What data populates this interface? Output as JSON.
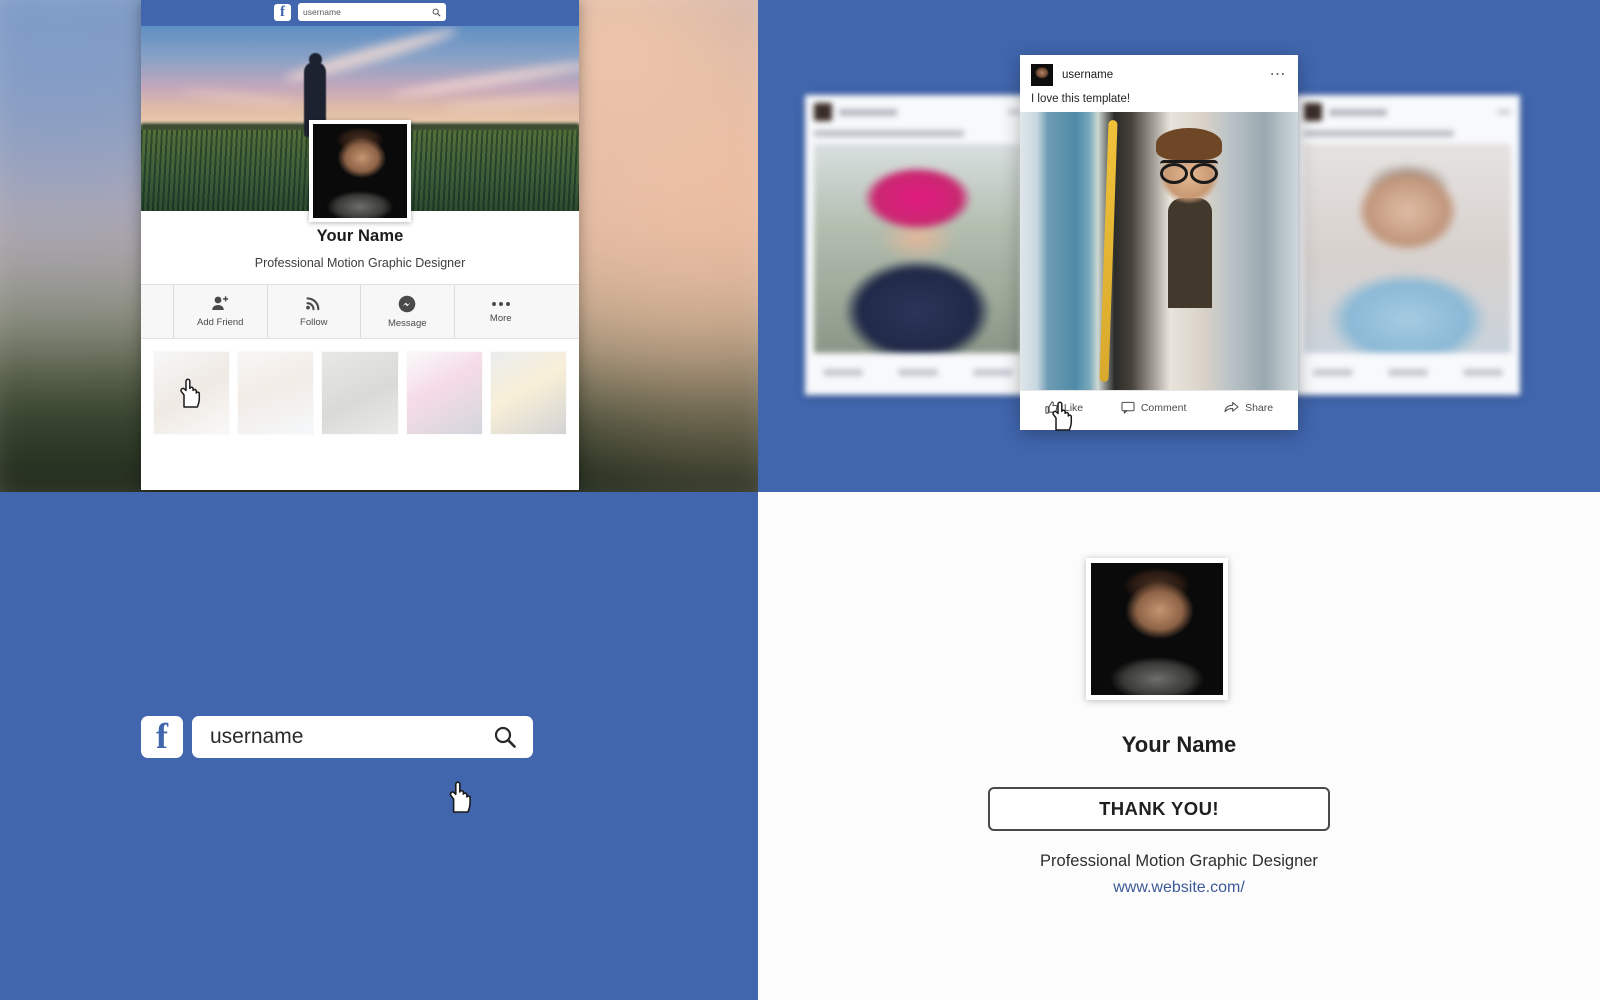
{
  "colors": {
    "facebook_blue": "#4166ae",
    "link_blue": "#3c5a9a",
    "panel_white": "#ffffff"
  },
  "profile_panel": {
    "topbar": {
      "logo": "facebook-f-logo",
      "search_value": "username",
      "search_icon": "search-icon"
    },
    "cover_photo_alt": "sunset-field-cover-photo",
    "avatar_alt": "profile-portrait",
    "name": "Your Name",
    "subtitle": "Professional Motion Graphic Designer",
    "actions": [
      {
        "label": "Add Friend",
        "icon": "add-friend-icon"
      },
      {
        "label": "Follow",
        "icon": "rss-follow-icon"
      },
      {
        "label": "Message",
        "icon": "messenger-icon"
      },
      {
        "label": "More",
        "icon": "ellipsis-icon"
      }
    ],
    "photo_strip": [
      "photo-thumbnail-1",
      "photo-thumbnail-2",
      "photo-thumbnail-3",
      "photo-thumbnail-4",
      "photo-thumbnail-5"
    ]
  },
  "feed_panel": {
    "post": {
      "username": "username",
      "menu_icon": "ellipsis-icon",
      "caption": "I love this template!",
      "image_alt": "man-with-glasses-on-train",
      "avatar_alt": "post-author-avatar",
      "actions": [
        {
          "label": "Like",
          "icon": "thumbs-up-icon"
        },
        {
          "label": "Comment",
          "icon": "comment-bubble-icon"
        },
        {
          "label": "Share",
          "icon": "share-arrow-icon"
        }
      ]
    },
    "background_posts": [
      {
        "image_alt": "girl-in-pink-hat-blurred"
      },
      {
        "image_alt": "girl-in-blue-dress-blurred"
      }
    ]
  },
  "search_panel": {
    "logo": "facebook-f-logo",
    "search_value": "username",
    "search_placeholder": "username",
    "search_icon": "search-icon"
  },
  "thanks_panel": {
    "avatar_alt": "profile-portrait",
    "name": "Your Name",
    "button_label": "THANK YOU!",
    "subtitle": "Professional Motion Graphic Designer",
    "website": "www.website.com/"
  }
}
